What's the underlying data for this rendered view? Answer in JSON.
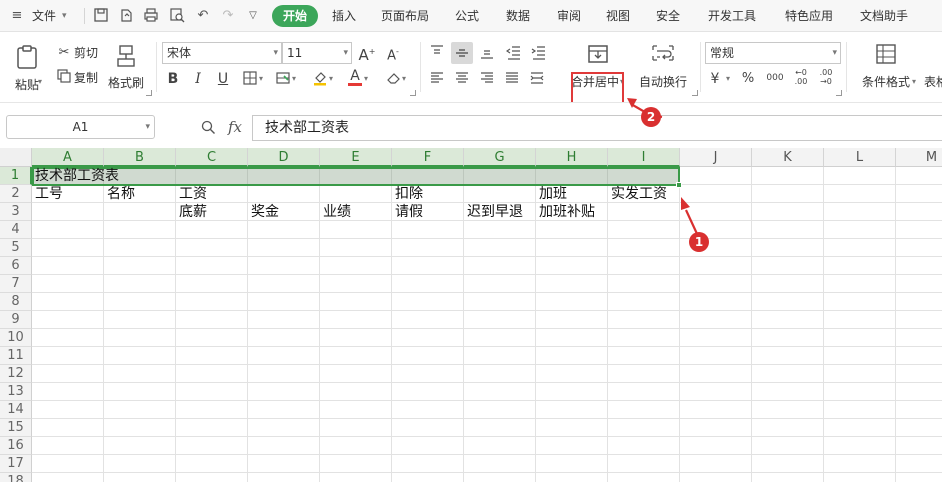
{
  "menubar": {
    "file_label": "文件",
    "tabs": [
      {
        "label": "开始",
        "active": true
      },
      {
        "label": "插入"
      },
      {
        "label": "页面布局"
      },
      {
        "label": "公式"
      },
      {
        "label": "数据"
      },
      {
        "label": "审阅"
      },
      {
        "label": "视图"
      },
      {
        "label": "安全"
      },
      {
        "label": "开发工具"
      },
      {
        "label": "特色应用"
      },
      {
        "label": "文档助手"
      }
    ]
  },
  "ribbon": {
    "paste_label": "粘贴",
    "cut_label": "剪切",
    "copy_label": "复制",
    "format_painter_label": "格式刷",
    "font_name": "宋体",
    "font_size": "11",
    "bold": "B",
    "italic": "I",
    "underline": "U",
    "merge_center_label": "合并居中",
    "wrap_text_label": "自动换行",
    "number_format": "常规",
    "percent": "%",
    "thousands": "000",
    "cond_format_label": "条件格式",
    "table_style_label": "表格"
  },
  "formula_bar": {
    "name_box": "A1",
    "fx": "fx",
    "value": "技术部工资表"
  },
  "sheet": {
    "columns": [
      "A",
      "B",
      "C",
      "D",
      "E",
      "F",
      "G",
      "H",
      "I",
      "J",
      "K",
      "L",
      "M"
    ],
    "rows": [
      "1",
      "2",
      "3",
      "4",
      "5",
      "6",
      "7",
      "8",
      "9",
      "10",
      "11",
      "12",
      "13",
      "14",
      "15",
      "16",
      "17",
      "18"
    ],
    "cells": {
      "A1": "技术部工资表",
      "A2": "工号",
      "B2": "名称",
      "C2": "工资",
      "F2": "扣除",
      "H2": "加班",
      "I2": "实发工资",
      "C3": "底薪",
      "D3": "奖金",
      "E3": "业绩",
      "F3": "请假",
      "G3": "迟到早退",
      "H3": "加班补贴"
    }
  },
  "annotations": {
    "badge_1": "1",
    "badge_2": "2",
    "color": "#d93030"
  },
  "colors": {
    "accent_green": "#3ca65a",
    "selection_green": "#3a9a48"
  }
}
